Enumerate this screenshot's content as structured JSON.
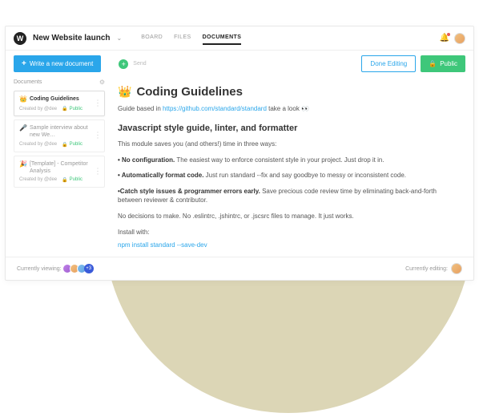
{
  "header": {
    "project_title": "New Website launch",
    "tabs": [
      "BOARD",
      "FILES",
      "DOCUMENTS"
    ]
  },
  "toolbar": {
    "write_label": "Write a new document",
    "send_label": "Send",
    "done_editing": "Done Editing",
    "public_label": "Public"
  },
  "sidebar": {
    "heading": "Documents",
    "items": [
      {
        "emoji": "👑",
        "title": "Coding Guidelines",
        "creator": "Created by @dee",
        "badge": "Public"
      },
      {
        "emoji": "🎤",
        "title": "Sample interview about new We…",
        "creator": "Created by @dee",
        "badge": "Public"
      },
      {
        "emoji": "🎉",
        "title": "[Template] - Competitor Analysis",
        "creator": "Created by @dee",
        "badge": "Public"
      }
    ]
  },
  "page": {
    "emoji": "👑",
    "title": "Coding Guidelines",
    "intro_pre": "Guide based in ",
    "intro_link": "https://github.com/standard/standard",
    "intro_post": " take a look 👀",
    "h2": "Javascript style guide, linter, and formatter",
    "p1": "This module saves you (and others!) time in three ways:",
    "b1_strong": "• No configuration.",
    "b1_rest": " The easiest way to enforce consistent style in your project. Just drop it in.",
    "b2_strong": "• Automatically format code.",
    "b2_rest": " Just run standard --fix and say goodbye to messy or inconsistent code.",
    "b3_strong": "•Catch style issues & programmer errors early.",
    "b3_rest": " Save precious code review time by eliminating back-and-forth between reviewer & contributor.",
    "p2": "No decisions to make. No .eslintrc, .jshintrc, or .jscsrc files to manage. It just works.",
    "p3": "Install with:",
    "code": "npm install standard --save-dev"
  },
  "footer": {
    "viewing_label": "Currently viewing:",
    "more_count": "+3",
    "editing_label": "Currently editing:"
  }
}
